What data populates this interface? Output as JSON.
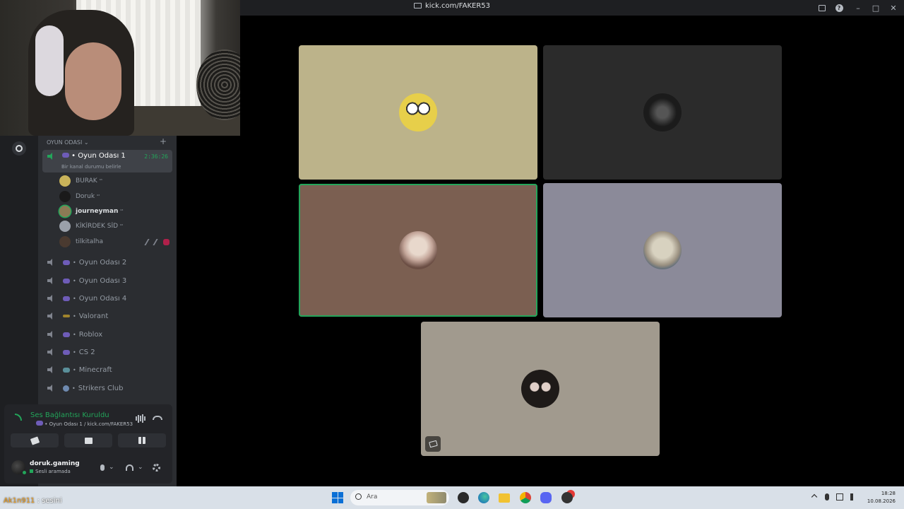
{
  "window": {
    "title": "kick.com/FAKER53",
    "controls": [
      "inbox-icon",
      "help-icon",
      "minimize-icon",
      "maximize-icon",
      "close-icon"
    ]
  },
  "sidebar": {
    "category": "OYUN ODASI",
    "active_channel": {
      "name": "Oyun Odası 1",
      "timer": "2:36:26",
      "status": "Bir kanal durumu belirle"
    },
    "members": [
      {
        "name": "BURAK",
        "badge": "⁶³",
        "bold": false,
        "avatar_color": "#c9b35a"
      },
      {
        "name": "Doruk",
        "badge": "⁶³",
        "bold": false,
        "avatar_color": "#1a1a1a"
      },
      {
        "name": "journeyman",
        "badge": "⁶³",
        "bold": true,
        "avatar_color": "#8b7a55"
      },
      {
        "name": "KİKİRDEK SİD",
        "badge": "⁶³",
        "bold": false,
        "avatar_color": "#9aa0aa"
      },
      {
        "name": "tilkitalha",
        "badge": "",
        "bold": false,
        "avatar_color": "#4a3a30"
      }
    ],
    "channels": [
      {
        "name": "Oyun Odası 2"
      },
      {
        "name": "Oyun Odası 3"
      },
      {
        "name": "Oyun Odası 4"
      },
      {
        "name": "Valorant"
      },
      {
        "name": "Roblox"
      },
      {
        "name": "CS 2"
      },
      {
        "name": "Minecraft"
      },
      {
        "name": "Strikers Club"
      }
    ]
  },
  "voice_panel": {
    "title": "Ses Bağlantısı Kuruldu",
    "subtitle": "Oyun Odası 1 / kick.com/FAKER53"
  },
  "user_panel": {
    "username": "doruk.gaming",
    "status": "Sesli aramada"
  },
  "stage": {
    "tiles": [
      {
        "bg": "#bcb38a",
        "avatar": "minion"
      },
      {
        "bg": "#2b2b2b",
        "avatar": "dkgaming"
      },
      {
        "bg": "#7b5f51",
        "avatar": "old-man",
        "speaking": true
      },
      {
        "bg": "#8b8a99",
        "avatar": "sloth"
      },
      {
        "bg": "#a19a8e",
        "avatar": "duo",
        "camera_off_badge": true
      }
    ]
  },
  "chat_overlay": {
    "nick": "Ak1n911",
    "message": " : sesini"
  },
  "taskbar": {
    "search_placeholder": "Ara",
    "time": "18:28",
    "date": "10.08.2026"
  },
  "colors": {
    "accent_green": "#23a55a",
    "discord_dark": "#2b2d31",
    "taskbar": "#d9e0e8"
  }
}
